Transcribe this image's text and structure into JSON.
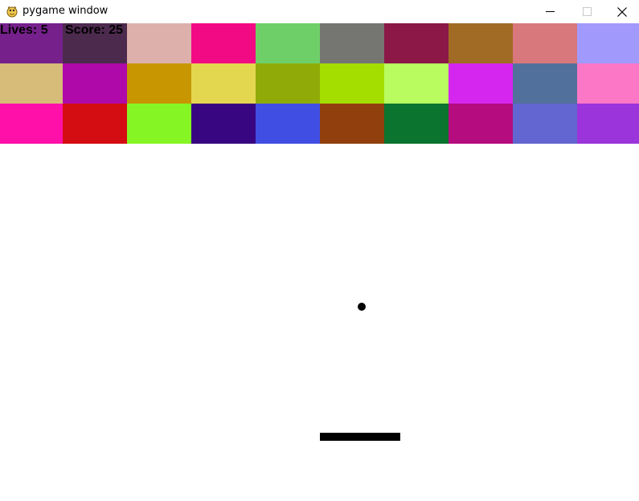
{
  "window": {
    "title": "pygame window",
    "icon": "pygame-snake-icon",
    "controls": {
      "minimize_icon": "minimize-icon",
      "maximize_icon": "maximize-icon",
      "close_icon": "close-icon"
    }
  },
  "hud": {
    "lives_text": "Lives: 5",
    "score_text": "Score: 25"
  },
  "bricks": {
    "rows": [
      [
        "#76208c",
        "#4c2a4d",
        "#deb0ac",
        "#f20a85",
        "#6ecf68",
        "#757672",
        "#8b1847",
        "#a16b25",
        "#d9787c",
        "#a299fc"
      ],
      [
        "#d6bb79",
        "#b009a9",
        "#c79600",
        "#e4d750",
        "#90ab08",
        "#a4dd00",
        "#b8fc60",
        "#d426ee",
        "#52709c",
        "#fd77c7"
      ],
      [
        "#fe10a9",
        "#d40d12",
        "#86f524",
        "#380681",
        "#414ee3",
        "#91400d",
        "#0b742f",
        "#b50c80",
        "#6365d0",
        "#9b35db"
      ]
    ]
  },
  "colors": {
    "background": "#ffffff",
    "ball": "#000000",
    "paddle": "#000000",
    "hud_text": "#000000"
  }
}
